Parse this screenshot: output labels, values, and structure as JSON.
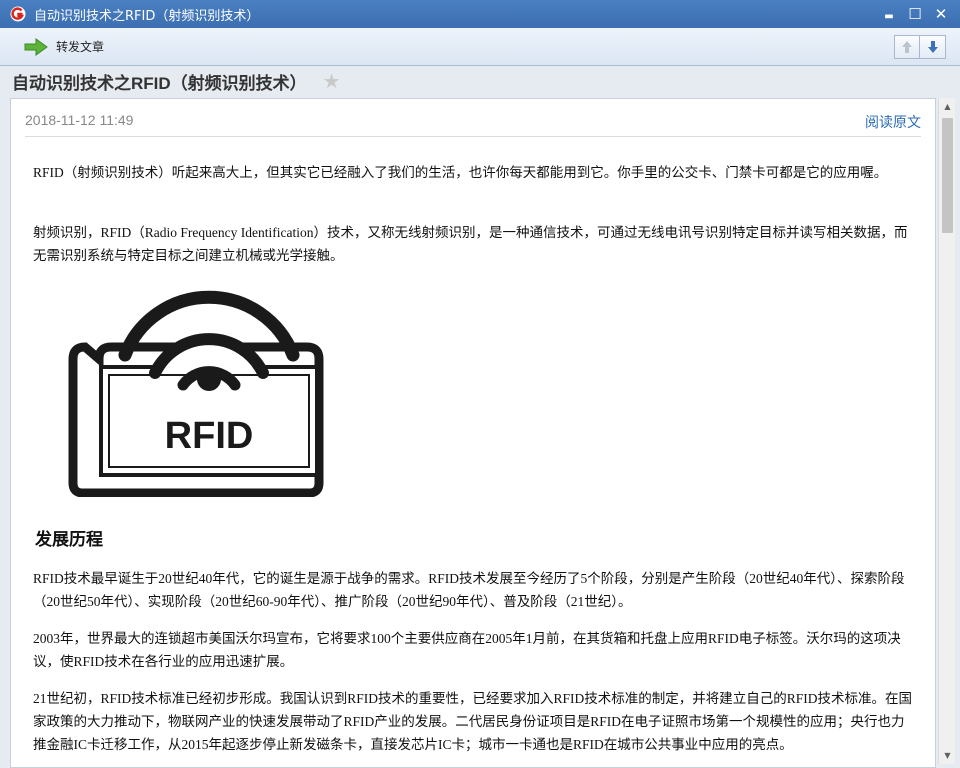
{
  "window": {
    "title": "自动识别技术之RFID（射频识别技术）",
    "controls": {
      "minimize": "▬",
      "maximize": "☐",
      "close": "✕"
    }
  },
  "toolbar": {
    "forward_label": "转发文章",
    "prev_icon": "arrow-up-icon",
    "next_icon": "arrow-down-icon"
  },
  "article": {
    "heading": "自动识别技术之RFID（射频识别技术）",
    "star": "★",
    "date": "2018-11-12 11:49",
    "read_original": "阅读原文",
    "paragraphs": [
      "RFID（射频识别技术）听起来高大上，但其实它已经融入了我们的生活，也许你每天都能用到它。你手里的公交卡、门禁卡可都是它的应用喔。",
      "射频识别，RFID（Radio Frequency Identification）技术，又称无线射频识别，是一种通信技术，可通过无线电讯号识别特定目标并读写相关数据，而无需识别系统与特定目标之间建立机械或光学接触。"
    ],
    "image_text": "RFID",
    "section_heading": "发展历程",
    "history_paragraphs": [
      "RFID技术最早诞生于20世纪40年代，它的诞生是源于战争的需求。RFID技术发展至今经历了5个阶段，分别是产生阶段（20世纪40年代）、探索阶段（20世纪50年代）、实现阶段（20世纪60-90年代）、推广阶段（20世纪90年代）、普及阶段（21世纪）。",
      "2003年，世界最大的连锁超市美国沃尔玛宣布，它将要求100个主要供应商在2005年1月前，在其货箱和托盘上应用RFID电子标签。沃尔玛的这项决议，使RFID技术在各行业的应用迅速扩展。",
      "21世纪初，RFID技术标准已经初步形成。我国认识到RFID技术的重要性，已经要求加入RFID技术标准的制定，并将建立自己的RFID技术标准。在国家政策的大力推动下，物联网产业的快速发展带动了RFID产业的发展。二代居民身份证项目是RFID在电子证照市场第一个规模性的应用；央行也力推金融IC卡迁移工作，从2015年起逐步停止新发磁条卡，直接发芯片IC卡；城市一卡通也是RFID在城市公共事业中应用的亮点。"
    ]
  },
  "scrollbar": {
    "up": "▲",
    "down": "▼"
  },
  "colors": {
    "titlebar": "#3b6fb2",
    "link": "#2b6cb5",
    "date": "#888888"
  }
}
